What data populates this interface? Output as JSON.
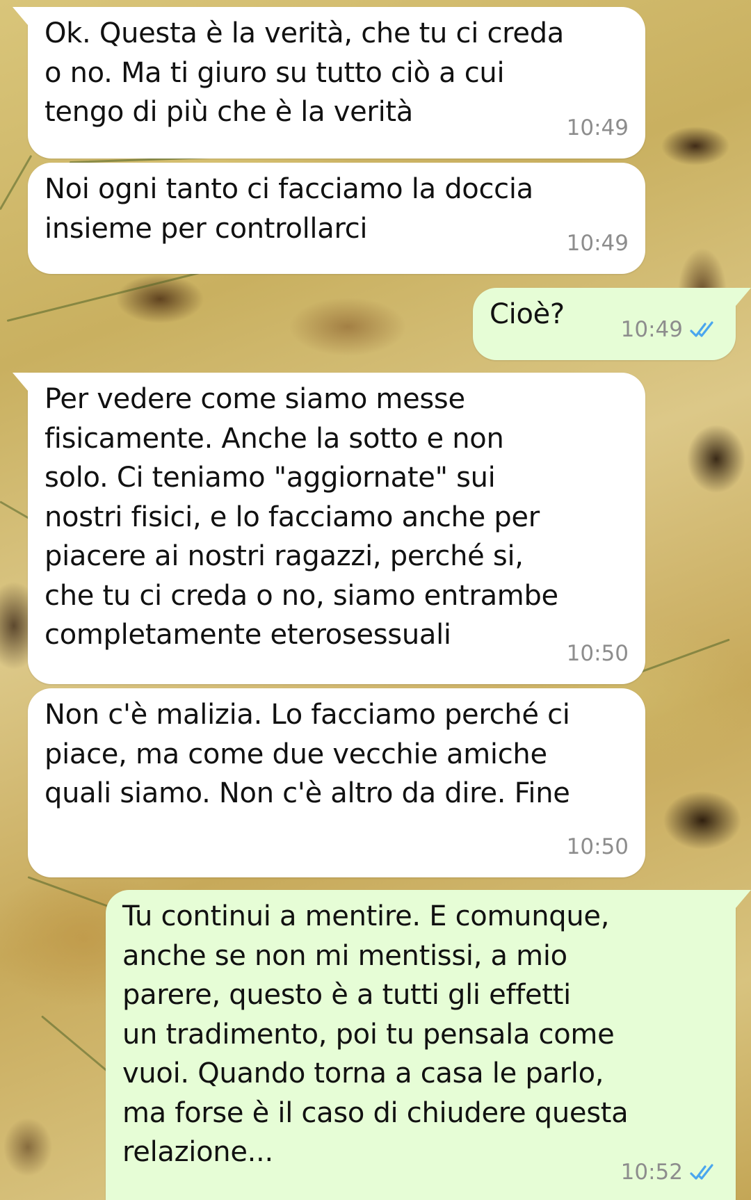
{
  "chat": {
    "accent_read_ticks": "#4aa6ee",
    "incoming_bubble_color": "#ffffff",
    "outgoing_bubble_color": "#e6fdd6",
    "messages": [
      {
        "direction": "incoming",
        "text": "Ok. Questa è la verità, che tu ci creda\no no. Ma ti giuro su tutto ciò a cui\ntengo di più che è la verità",
        "time": "10:49"
      },
      {
        "direction": "incoming",
        "text": "Noi ogni tanto ci facciamo la doccia\ninsieme per controllarci",
        "time": "10:49"
      },
      {
        "direction": "outgoing",
        "text": "Cioè?",
        "time": "10:49",
        "status_icon": "double-check-read-icon"
      },
      {
        "direction": "incoming",
        "text": "Per vedere come siamo messe\nfisicamente. Anche la sotto e non\nsolo. Ci teniamo \"aggiornate\" sui\nnostri fisici, e lo facciamo anche per\npiacere ai nostri ragazzi, perché si,\nche tu ci creda o no, siamo entrambe\ncompletamente eterosessuali",
        "time": "10:50"
      },
      {
        "direction": "incoming",
        "text": "Non c'è malizia. Lo facciamo perché ci\npiace, ma come due vecchie amiche\nquali siamo. Non c'è altro da dire. Fine",
        "time": "10:50"
      },
      {
        "direction": "outgoing",
        "text": "Tu continui a mentire. E comunque,\nanche se non mi mentissi, a mio\nparere, questo è a tutti gli effetti\nun tradimento, poi tu pensala come\nvuoi. Quando torna a casa le parlo,\nma forse è il caso di chiudere questa\nrelazione...",
        "time": "10:52",
        "status_icon": "double-check-read-icon"
      }
    ]
  }
}
